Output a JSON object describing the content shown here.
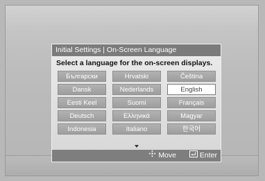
{
  "dialog": {
    "title": "Initial Settings | On-Screen Language",
    "prompt": "Select a language for the on-screen displays.",
    "languages": [
      {
        "label": "Български"
      },
      {
        "label": "Hrvatski"
      },
      {
        "label": "Čeština"
      },
      {
        "label": "Dansk"
      },
      {
        "label": "Nederlands"
      },
      {
        "label": "English"
      },
      {
        "label": "Eesti Keel"
      },
      {
        "label": "Suomi"
      },
      {
        "label": "Français"
      },
      {
        "label": "Deutsch"
      },
      {
        "label": "Ελληνικά"
      },
      {
        "label": "Magyar"
      },
      {
        "label": "Indonesia"
      },
      {
        "label": "Italiano"
      },
      {
        "label": "한국어"
      }
    ],
    "selected_language": "English",
    "footer": {
      "move_label": "Move",
      "enter_label": "Enter",
      "move_icon": "dpad-icon",
      "enter_icon": "enter-icon"
    }
  }
}
